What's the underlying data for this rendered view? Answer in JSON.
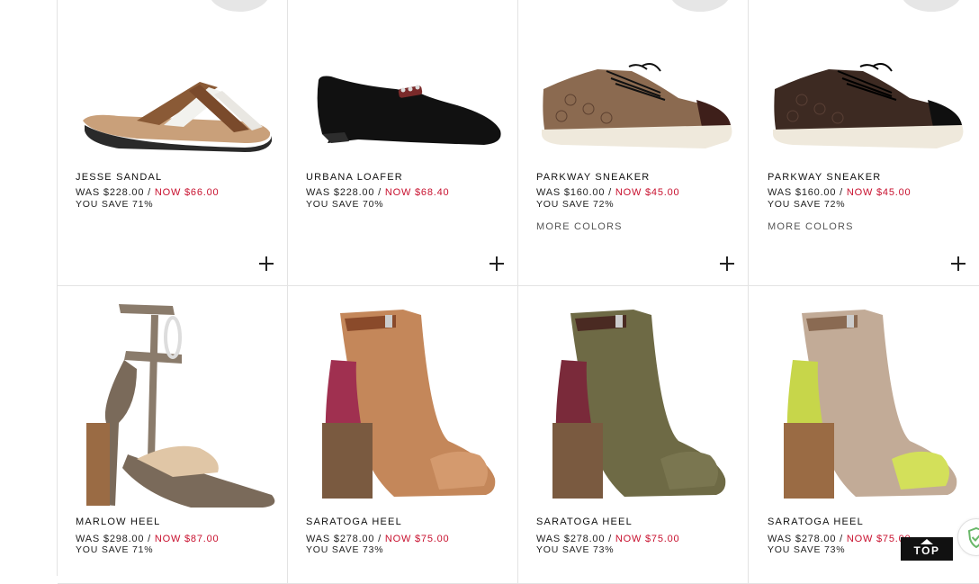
{
  "products": [
    {
      "name": "JESSE SANDAL",
      "was": "WAS $228.00 /",
      "now": "NOW $66.00",
      "save": "YOU SAVE 71%",
      "more": ""
    },
    {
      "name": "URBANA LOAFER",
      "was": "WAS $228.00 /",
      "now": "NOW $68.40",
      "save": "YOU SAVE 70%",
      "more": ""
    },
    {
      "name": "PARKWAY SNEAKER",
      "was": "WAS $160.00 /",
      "now": "NOW $45.00",
      "save": "YOU SAVE 72%",
      "more": "MORE COLORS"
    },
    {
      "name": "PARKWAY SNEAKER",
      "was": "WAS $160.00 /",
      "now": "NOW $45.00",
      "save": "YOU SAVE 72%",
      "more": "MORE COLORS"
    },
    {
      "name": "MARLOW HEEL",
      "was": "WAS $298.00 /",
      "now": "NOW $87.00",
      "save": "YOU SAVE 71%",
      "more": ""
    },
    {
      "name": "SARATOGA HEEL",
      "was": "WAS $278.00 /",
      "now": "NOW $75.00",
      "save": "YOU SAVE 73%",
      "more": ""
    },
    {
      "name": "SARATOGA HEEL",
      "was": "WAS $278.00 /",
      "now": "NOW $75.00",
      "save": "YOU SAVE 73%",
      "more": ""
    },
    {
      "name": "SARATOGA HEEL",
      "was": "WAS $278.00 /",
      "now": "NOW $75.00",
      "save": "YOU SAVE 73%",
      "more": ""
    }
  ],
  "top_button": {
    "label": "TOP"
  },
  "colors": {
    "sale_red": "#c8102e",
    "grid_border": "#e3e3e3"
  }
}
